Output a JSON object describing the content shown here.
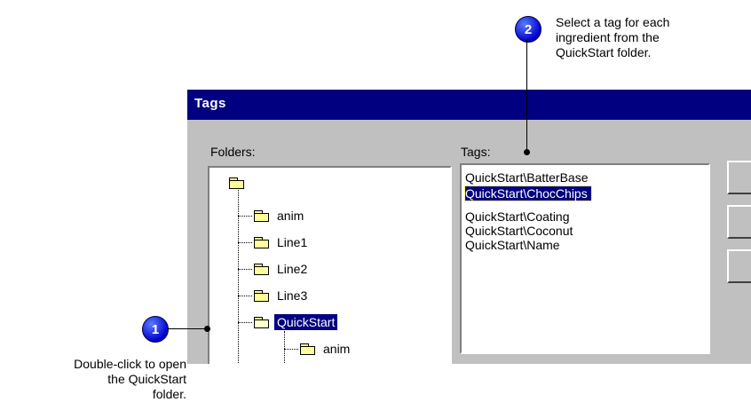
{
  "dialog": {
    "title": "Tags",
    "folders_label": "Folders:",
    "tags_label": "Tags:",
    "folders": [
      {
        "label": "",
        "icon": "folder-icon"
      },
      {
        "label": "anim",
        "icon": "folder-icon"
      },
      {
        "label": "Line1",
        "icon": "folder-icon"
      },
      {
        "label": "Line2",
        "icon": "folder-icon"
      },
      {
        "label": "Line3",
        "icon": "folder-icon"
      },
      {
        "label": "QuickStart",
        "icon": "folder-open-icon",
        "selected": true
      },
      {
        "label": "anim",
        "icon": "folder-icon"
      }
    ],
    "tags": [
      {
        "label": "QuickStart\\BatterBase"
      },
      {
        "label": "QuickStart\\ChocChips",
        "selected": true
      },
      {
        "label": "QuickStart\\Coating"
      },
      {
        "label": "QuickStart\\Coconut"
      },
      {
        "label": "QuickStart\\Name"
      }
    ]
  },
  "callouts": {
    "one": {
      "number": "1",
      "text_lines": [
        "Double-click to open",
        "the QuickStart",
        "folder."
      ]
    },
    "two": {
      "number": "2",
      "text_lines": [
        "Select a tag for each",
        "ingredient from the",
        "QuickStart folder."
      ]
    }
  },
  "colors": {
    "title_bar": "#000080",
    "dialog_face": "#c0c0c0",
    "selection": "#000080",
    "badge": "#0000cc"
  }
}
